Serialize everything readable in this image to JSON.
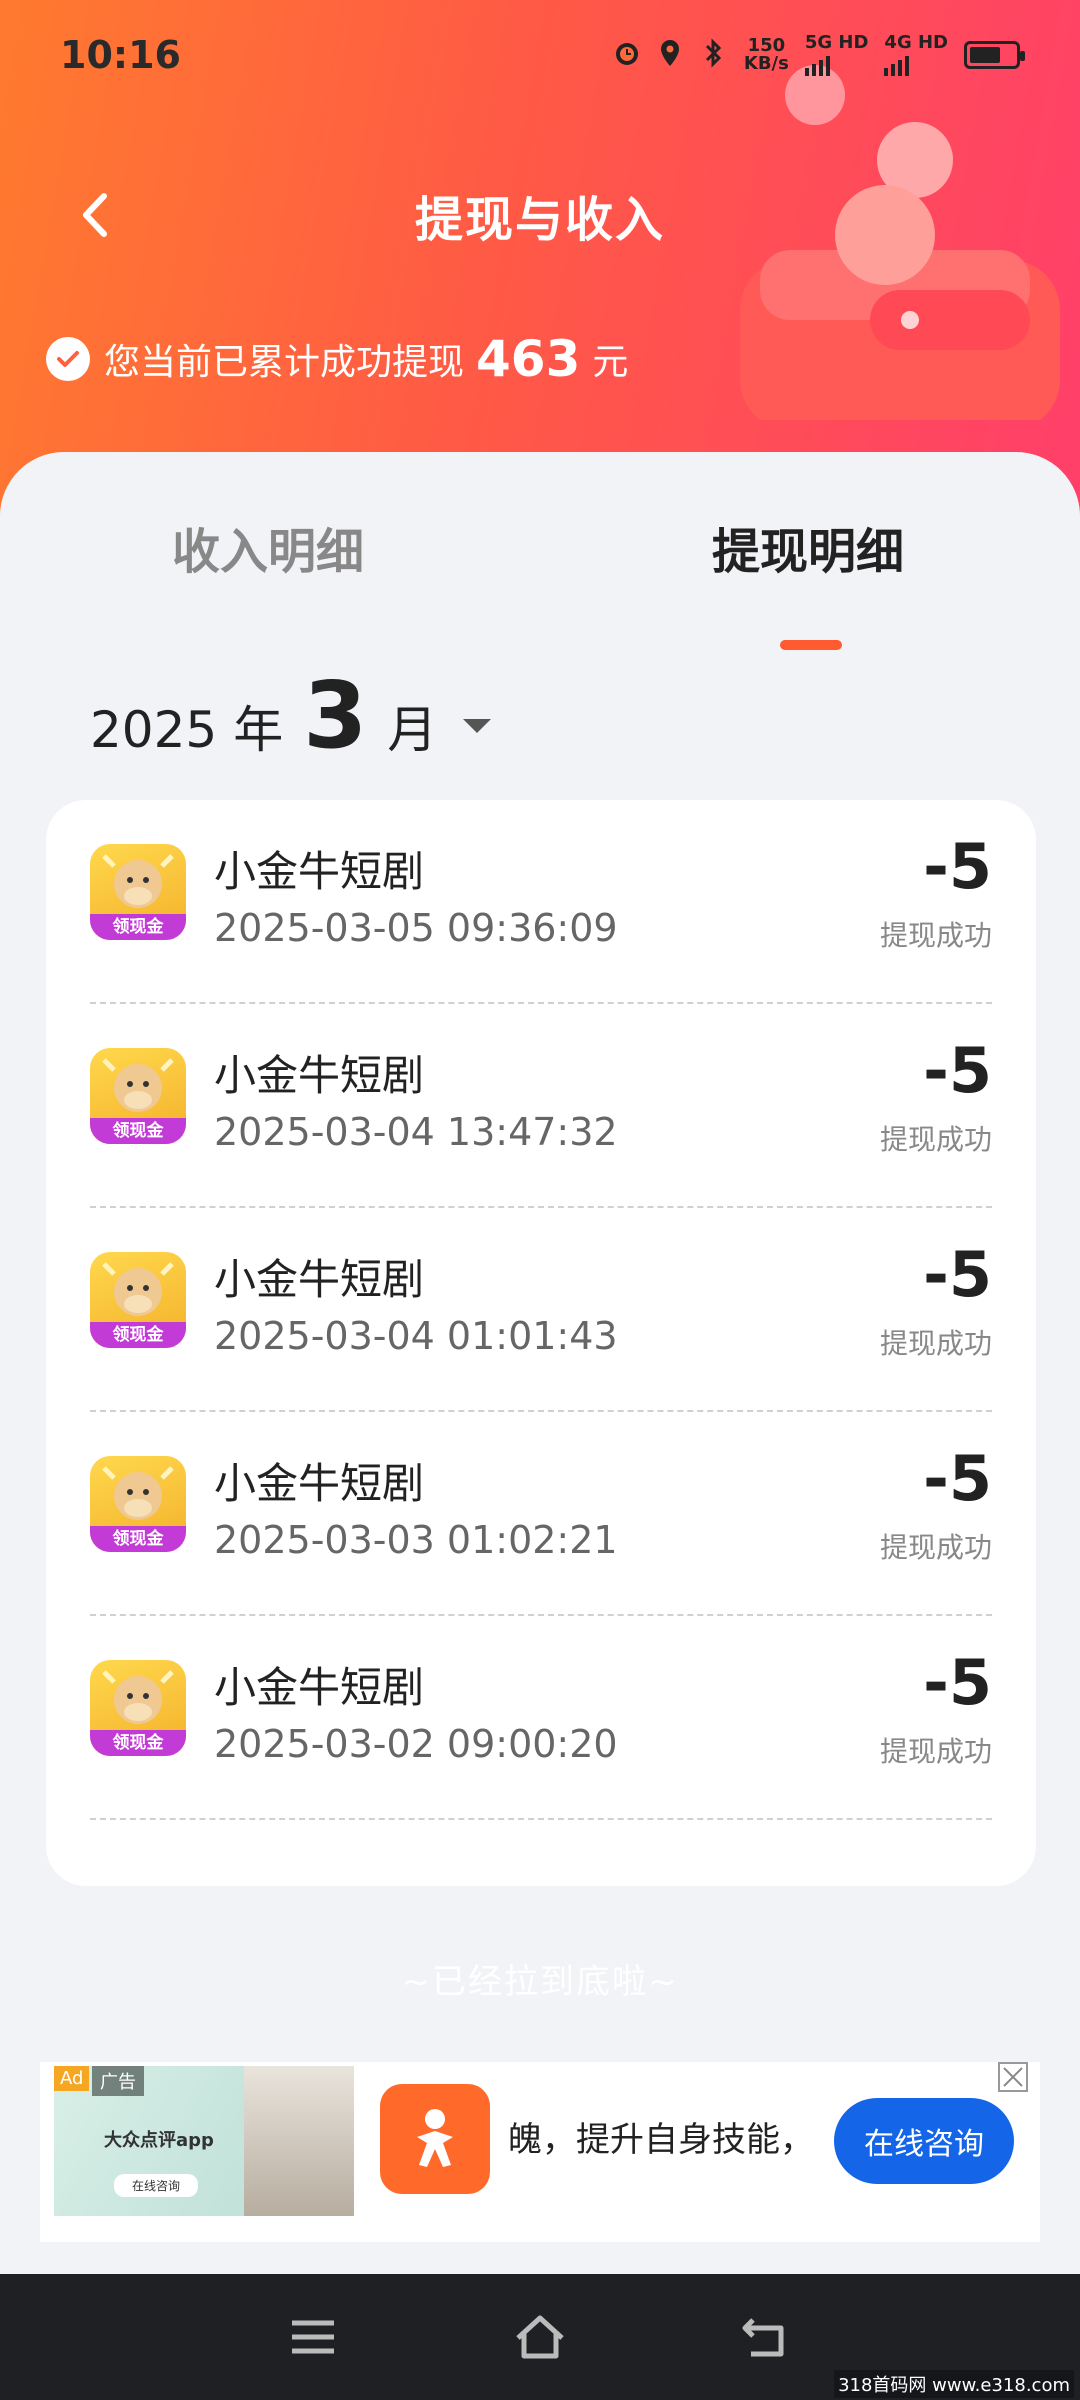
{
  "status_bar": {
    "time": "10:16",
    "net_speed_value": "150",
    "net_speed_unit": "KB/s",
    "sim1": "5G HD",
    "sim2": "4G HD"
  },
  "header": {
    "title": "提现与收入",
    "summary_text": "您当前已累计成功提现",
    "summary_amount": "463",
    "summary_unit": "元"
  },
  "tabs": [
    {
      "label": "收入明细",
      "active": false
    },
    {
      "label": "提现明细",
      "active": true
    }
  ],
  "month_picker": {
    "year": "2025",
    "year_unit": "年",
    "month": "3",
    "month_unit": "月"
  },
  "records": [
    {
      "name": "小金牛短剧",
      "time": "2025-03-05 09:36:09",
      "amount": "-5",
      "status": "提现成功",
      "icon_badge": "领现金"
    },
    {
      "name": "小金牛短剧",
      "time": "2025-03-04 13:47:32",
      "amount": "-5",
      "status": "提现成功",
      "icon_badge": "领现金"
    },
    {
      "name": "小金牛短剧",
      "time": "2025-03-04 01:01:43",
      "amount": "-5",
      "status": "提现成功",
      "icon_badge": "领现金"
    },
    {
      "name": "小金牛短剧",
      "time": "2025-03-03 01:02:21",
      "amount": "-5",
      "status": "提现成功",
      "icon_badge": "领现金"
    },
    {
      "name": "小金牛短剧",
      "time": "2025-03-02 09:00:20",
      "amount": "-5",
      "status": "提现成功",
      "icon_badge": "领现金"
    }
  ],
  "end_hint": "~已经拉到底啦~",
  "ad": {
    "tag": "Ad",
    "tag2": "广告",
    "thumb_title": "大众点评app",
    "thumb_button": "在线咨询",
    "text": "魄，提升自身技能，",
    "cta": "在线咨询"
  },
  "watermark": "318首码网 www.e318.com",
  "colors": {
    "header_start": "#ff7a2f",
    "header_end": "#ff3f6a",
    "tab_indicator": "#ff5a30",
    "cta_blue": "#1565e8"
  }
}
